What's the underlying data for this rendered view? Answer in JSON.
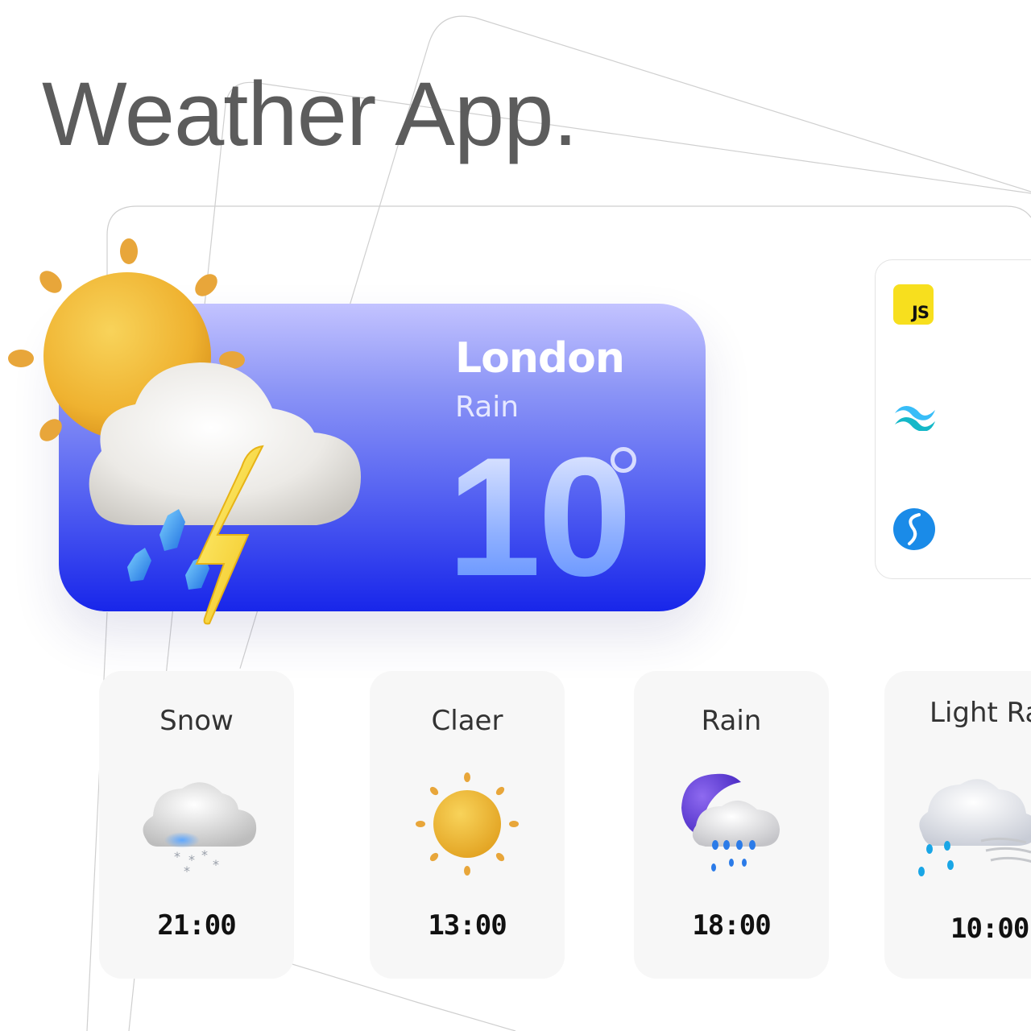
{
  "title": "Weather App.",
  "current": {
    "city": "London",
    "condition": "Rain",
    "temperature": "10",
    "icon": "sun-storm-icon"
  },
  "tech_stack": [
    {
      "name": "javascript-logo",
      "label": "JS"
    },
    {
      "name": "tailwind-logo"
    },
    {
      "name": "stylus-logo"
    }
  ],
  "forecast": [
    {
      "label": "Snow",
      "time": "21:00",
      "icon": "snow-cloud-icon"
    },
    {
      "label": "Claer",
      "time": "13:00",
      "icon": "sun-icon"
    },
    {
      "label": "Rain",
      "time": "18:00",
      "icon": "moon-rain-icon"
    },
    {
      "label": "Light Ra",
      "time": "10:00",
      "icon": "light-rain-wind-icon"
    }
  ],
  "colors": {
    "card_top": "#c3c3ff",
    "card_bottom": "#1826ea",
    "sun": "#f2b52e",
    "title": "#5c5c5c"
  }
}
